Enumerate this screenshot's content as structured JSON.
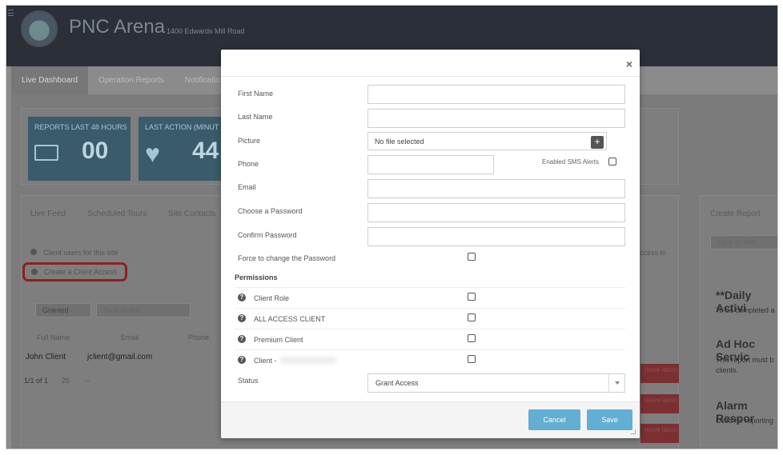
{
  "background": {
    "venue_name": "PNC Arena",
    "address": "1400 Edwards Mill Road",
    "nav_tabs": [
      "Live Dashboard",
      "Operation Reports",
      "Notificatio"
    ],
    "stats": [
      {
        "label": "REPORTS LAST 48 HOURS",
        "value": "00"
      },
      {
        "label": "LAST ACTION (MINUT",
        "value": "44"
      }
    ],
    "panel_tabs": [
      "Live Feed",
      "Scheduled Tours",
      "Site Contacts"
    ],
    "client_users_title": "Client users for this site",
    "create_client_access": "Create a Client Access",
    "granted": "Granted",
    "type_to_filter": "Type to filter",
    "table": {
      "headers": [
        "Full Name",
        "Email",
        "Phone"
      ],
      "row": [
        "John Client",
        "jclient@gmail.com",
        ""
      ]
    },
    "pagination": [
      "1/1 of 1",
      "25",
      "--"
    ],
    "access_to": "ccess to",
    "remove_relation": "move\nlation",
    "right_panel": {
      "tab": "Create Report",
      "filter_placeholder": "Type to filter",
      "reports": [
        {
          "title": "**Daily Activi",
          "desc": "To be completed a"
        },
        {
          "title": "Ad Hoc Servic",
          "desc": "This report must b\nclients."
        },
        {
          "title": "Alarm Respor",
          "desc": "Used for reporting"
        }
      ]
    }
  },
  "modal": {
    "close": "×",
    "labels": {
      "first_name": "First Name",
      "last_name": "Last Name",
      "picture": "Picture",
      "phone": "Phone",
      "email": "Email",
      "choose_password": "Choose a Password",
      "confirm_password": "Confirm Password",
      "force_change": "Force to change the Password",
      "enabled_sms": "Enabled SMS Alerts",
      "permissions": "Permissions",
      "status": "Status"
    },
    "picture_value": "No file selected",
    "permissions": [
      "Client Role",
      "ALL ACCESS CLIENT",
      "Premium Client",
      "Client -"
    ],
    "status_value": "Grant Access",
    "buttons": {
      "cancel": "Cancel",
      "save": "Save"
    }
  }
}
